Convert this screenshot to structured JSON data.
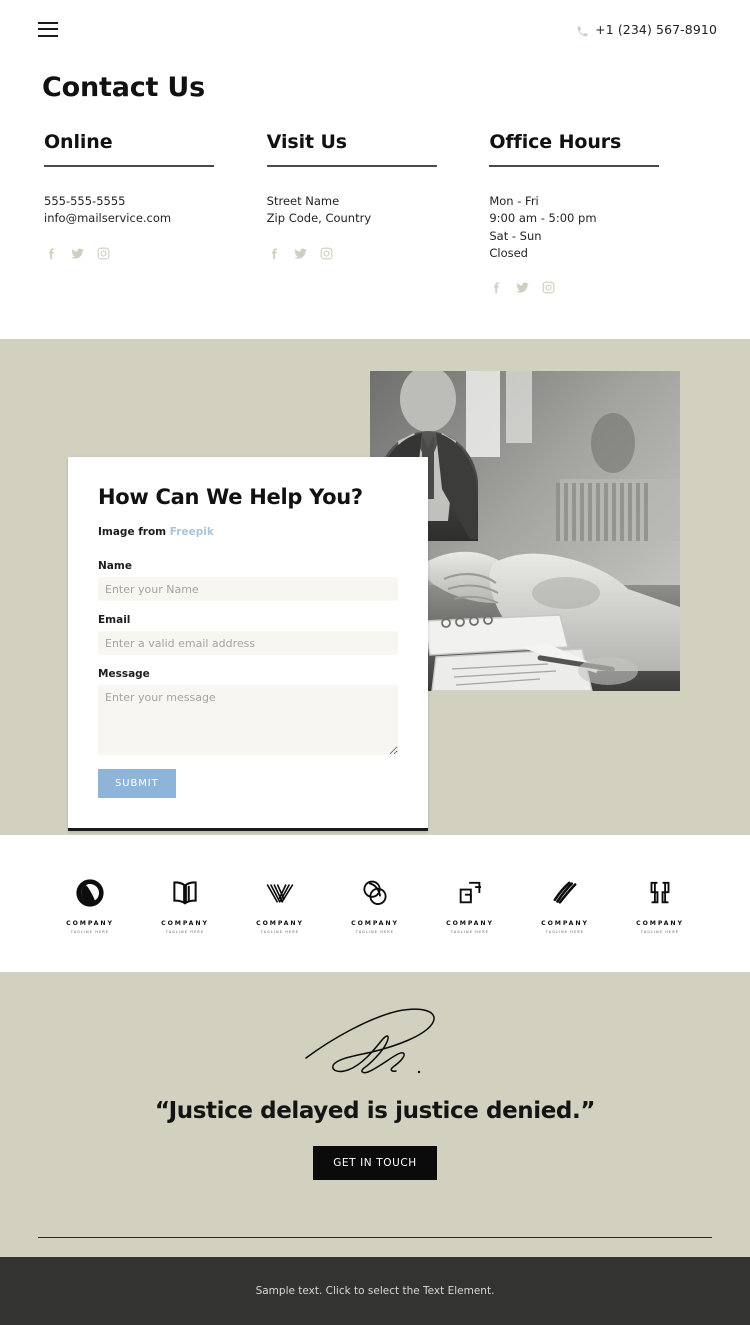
{
  "header": {
    "menu_icon": "hamburger-menu-icon",
    "phone_icon": "phone-icon",
    "phone": "+1 (234) 567-8910"
  },
  "page_title": "Contact Us",
  "columns": [
    {
      "heading": "Online",
      "lines": [
        "555-555-5555",
        "info@mailservice.com"
      ],
      "socials": [
        "facebook-icon",
        "twitter-icon",
        "instagram-icon"
      ]
    },
    {
      "heading": "Visit Us",
      "lines": [
        "Street Name",
        "Zip Code, Country"
      ],
      "socials": [
        "facebook-icon",
        "twitter-icon",
        "instagram-icon"
      ]
    },
    {
      "heading": "Office Hours",
      "lines": [
        "Mon - Fri",
        "9:00 am - 5:00 pm",
        "Sat - Sun",
        "Closed"
      ],
      "socials": [
        "facebook-icon",
        "twitter-icon",
        "instagram-icon"
      ]
    }
  ],
  "form": {
    "heading": "How Can We Help You?",
    "credit_prefix": "Image from ",
    "credit_link": "Freepik",
    "fields": [
      {
        "label": "Name",
        "placeholder": "Enter your Name",
        "value": ""
      },
      {
        "label": "Email",
        "placeholder": "Enter a valid email address",
        "value": ""
      },
      {
        "label": "Message",
        "placeholder": "Enter your message",
        "value": ""
      }
    ],
    "submit_label": "SUBMIT",
    "submit_color": "#8fb4d9"
  },
  "photo": {
    "alt": "handshake-photo",
    "description": "Black and white photo of a handshake over a desk with documents"
  },
  "logos": [
    {
      "mark": "swirl-circle-logo-icon",
      "name": "COMPANY",
      "tagline": "TAGLINE HERE"
    },
    {
      "mark": "open-book-logo-icon",
      "name": "COMPANY",
      "tagline": "TAGLINE HERE"
    },
    {
      "mark": "v-stripes-logo-icon",
      "name": "COMPANY",
      "tagline": "TAGLINE HERE"
    },
    {
      "mark": "interlocking-circles-logo-icon",
      "name": "COMPANY",
      "tagline": "TAGLINE HERE"
    },
    {
      "mark": "square-brackets-logo-icon",
      "name": "COMPANY",
      "tagline": "TAGLINE HERE"
    },
    {
      "mark": "diagonal-stripes-logo-icon",
      "name": "COMPANY",
      "tagline": "TAGLINE HERE"
    },
    {
      "mark": "mirrored-b-logo-icon",
      "name": "COMPANY",
      "tagline": "TAGLINE HERE"
    }
  ],
  "quote_section": {
    "signature": "signature-icon",
    "quote": "“Justice delayed is justice denied.”",
    "cta_label": "GET IN TOUCH"
  },
  "footer": {
    "text": "Sample text. Click to select the Text Element."
  },
  "colors": {
    "beige": "#d2d1bf",
    "footer_bg": "#333331",
    "accent_blue": "#8fb4d9",
    "cta_black": "#0b0b0b",
    "social_icon": "#cfcec0"
  }
}
